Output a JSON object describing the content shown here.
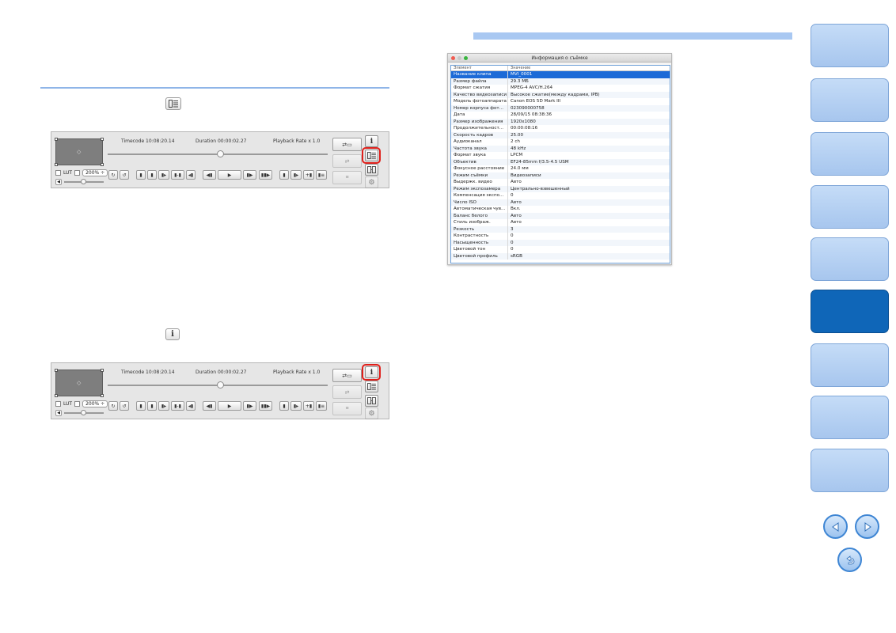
{
  "player1": {
    "timecode": "Timecode 10:08:20.14",
    "duration": "Duration 00:00:02.27",
    "playback_rate": "Playback Rate x 1.0",
    "lut_label": "LUT",
    "zoom_value": "200%"
  },
  "player2": {
    "timecode": "Timecode 10:08:20.14",
    "duration": "Duration 00:00:02.27",
    "playback_rate": "Playback Rate x 1.0",
    "lut_label": "LUT",
    "zoom_value": "200%"
  },
  "info_window": {
    "title": "Информация о съёмке",
    "col_element": "Элемент",
    "col_value": "Значение",
    "rows": [
      {
        "k": "Название клипа",
        "v": "MVI_0001"
      },
      {
        "k": "Размер файла",
        "v": "29.3 МБ"
      },
      {
        "k": "Формат сжатия",
        "v": "MPEG-4 AVC/H.264"
      },
      {
        "k": "Качество видеозаписи",
        "v": "Высокое сжатие(между кадрами, IPB)"
      },
      {
        "k": "Модель фотоаппарата",
        "v": "Canon EOS 5D Mark III"
      },
      {
        "k": "Номер корпуса фот...",
        "v": "023090000758"
      },
      {
        "k": "Дата",
        "v": "28/09/15 08:38:36"
      },
      {
        "k": "Размер изображения",
        "v": "1920x1080"
      },
      {
        "k": "Продолжительност...",
        "v": "00:00:08:16"
      },
      {
        "k": "Скорость кадров",
        "v": "25.00"
      },
      {
        "k": "Аудиоканал",
        "v": "2 ch"
      },
      {
        "k": "Частота звука",
        "v": "48 kHz"
      },
      {
        "k": "Формат звука",
        "v": "LPCM"
      },
      {
        "k": "Объектив",
        "v": "EF24-85mm f/3.5-4.5 USM"
      },
      {
        "k": "Фокусное расстояние",
        "v": "24.0 мм"
      },
      {
        "k": "Режим съёмки",
        "v": "Видеозаписи"
      },
      {
        "k": "Выдержк. видео",
        "v": "Авто"
      },
      {
        "k": "Режим экспозамера",
        "v": "Центрально-взвешенный"
      },
      {
        "k": "Компенсация экспо...",
        "v": "0"
      },
      {
        "k": "Число ISO",
        "v": "Авто"
      },
      {
        "k": "Автоматическая чув...",
        "v": "Вкл."
      },
      {
        "k": "Баланс белого",
        "v": "Авто"
      },
      {
        "k": "Стиль изображ.",
        "v": "Авто"
      },
      {
        "k": "Резкость",
        "v": "3"
      },
      {
        "k": "Контрастность",
        "v": "0"
      },
      {
        "k": "Насыщенность",
        "v": "0"
      },
      {
        "k": "Цветовой тон",
        "v": "0"
      },
      {
        "k": "Цветовой профиль",
        "v": "sRGB"
      }
    ]
  },
  "colors": {
    "accent_blue": "#0f66b8",
    "tab_blue": "#a7c6ee",
    "highlight_red": "#e0201b",
    "selection_blue": "#1c6ad7"
  },
  "icons": {
    "info": "i",
    "list_view": "list-view-icon",
    "prev_page": "arrow-left-icon",
    "next_page": "arrow-right-icon",
    "back": "return-icon"
  }
}
